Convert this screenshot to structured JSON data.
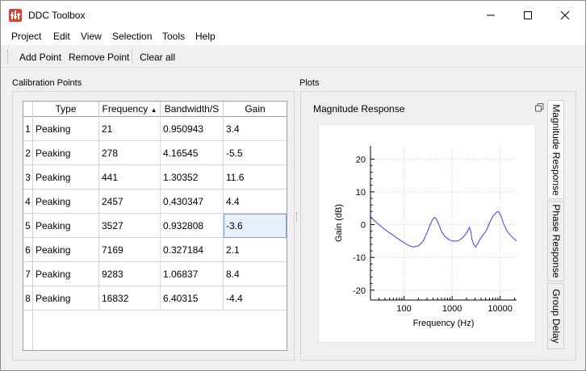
{
  "window": {
    "title": "DDC Toolbox"
  },
  "menu": [
    "Project",
    "Edit",
    "View",
    "Selection",
    "Tools",
    "Help"
  ],
  "toolbar": {
    "add_point": "Add Point",
    "remove_point": "Remove Point",
    "clear_all": "Clear all"
  },
  "calibration": {
    "group_label": "Calibration Points",
    "columns": [
      "Type",
      "Frequency",
      "Bandwidth/S",
      "Gain"
    ],
    "sort_indicator": "▲",
    "rows": [
      {
        "index": "1",
        "type": "Peaking",
        "frequency": "21",
        "bandwidth": "0.950943",
        "gain": "3.4"
      },
      {
        "index": "2",
        "type": "Peaking",
        "frequency": "278",
        "bandwidth": "4.16545",
        "gain": "-5.5"
      },
      {
        "index": "3",
        "type": "Peaking",
        "frequency": "441",
        "bandwidth": "1.30352",
        "gain": "11.6"
      },
      {
        "index": "4",
        "type": "Peaking",
        "frequency": "2457",
        "bandwidth": "0.430347",
        "gain": "4.4"
      },
      {
        "index": "5",
        "type": "Peaking",
        "frequency": "3527",
        "bandwidth": "0.932808",
        "gain": "-3.6"
      },
      {
        "index": "6",
        "type": "Peaking",
        "frequency": "7169",
        "bandwidth": "0.327184",
        "gain": "2.1"
      },
      {
        "index": "7",
        "type": "Peaking",
        "frequency": "9283",
        "bandwidth": "1.06837",
        "gain": "8.4"
      },
      {
        "index": "8",
        "type": "Peaking",
        "frequency": "16832",
        "bandwidth": "6.40315",
        "gain": "-4.4"
      }
    ]
  },
  "plots": {
    "group_label": "Plots",
    "title": "Magnitude Response",
    "tabs": [
      "Magnitude Response",
      "Phase Response",
      "Group Delay"
    ],
    "copy_icon": "copy-icon"
  },
  "chart_data": {
    "type": "line",
    "xlabel": "Frequency (Hz)",
    "ylabel": "Gain (dB)",
    "x_scale": "log",
    "xlim": [
      20,
      22000
    ],
    "ylim": [
      -23,
      24
    ],
    "xticks": [
      100,
      1000,
      10000
    ],
    "xtick_labels": [
      "100",
      "1000",
      "10000"
    ],
    "yticks": [
      -20,
      -10,
      0,
      10,
      20
    ],
    "ytick_labels": [
      "-20",
      "-10",
      "0",
      "10",
      "20"
    ],
    "grid": true,
    "color": "#3f3fd9",
    "series": [
      {
        "x": [
          20,
          25,
          30,
          40,
          50,
          70,
          100,
          130,
          160,
          200,
          250,
          300,
          350,
          400,
          440,
          480,
          530,
          600,
          700,
          850,
          1000,
          1300,
          1600,
          1900,
          2100,
          2300,
          2450,
          2600,
          2800,
          3100,
          3500,
          4000,
          4600,
          5300,
          6000,
          7000,
          8000,
          9000,
          9500,
          10500,
          12000,
          14000,
          17000,
          20000,
          22000
        ],
        "y": [
          2.5,
          1.0,
          0.0,
          -1.5,
          -2.5,
          -4.0,
          -5.5,
          -6.5,
          -6.8,
          -6.5,
          -5.0,
          -2.5,
          0.0,
          1.8,
          2.2,
          1.5,
          0.0,
          -2.0,
          -3.5,
          -4.5,
          -5.0,
          -5.0,
          -4.2,
          -3.0,
          -2.0,
          -0.8,
          -2.0,
          -4.5,
          -6.0,
          -6.8,
          -5.5,
          -4.0,
          -2.8,
          -1.5,
          0.5,
          2.5,
          3.5,
          4.0,
          3.8,
          2.5,
          0.0,
          -2.0,
          -3.5,
          -4.5,
          -5.0
        ]
      }
    ]
  }
}
